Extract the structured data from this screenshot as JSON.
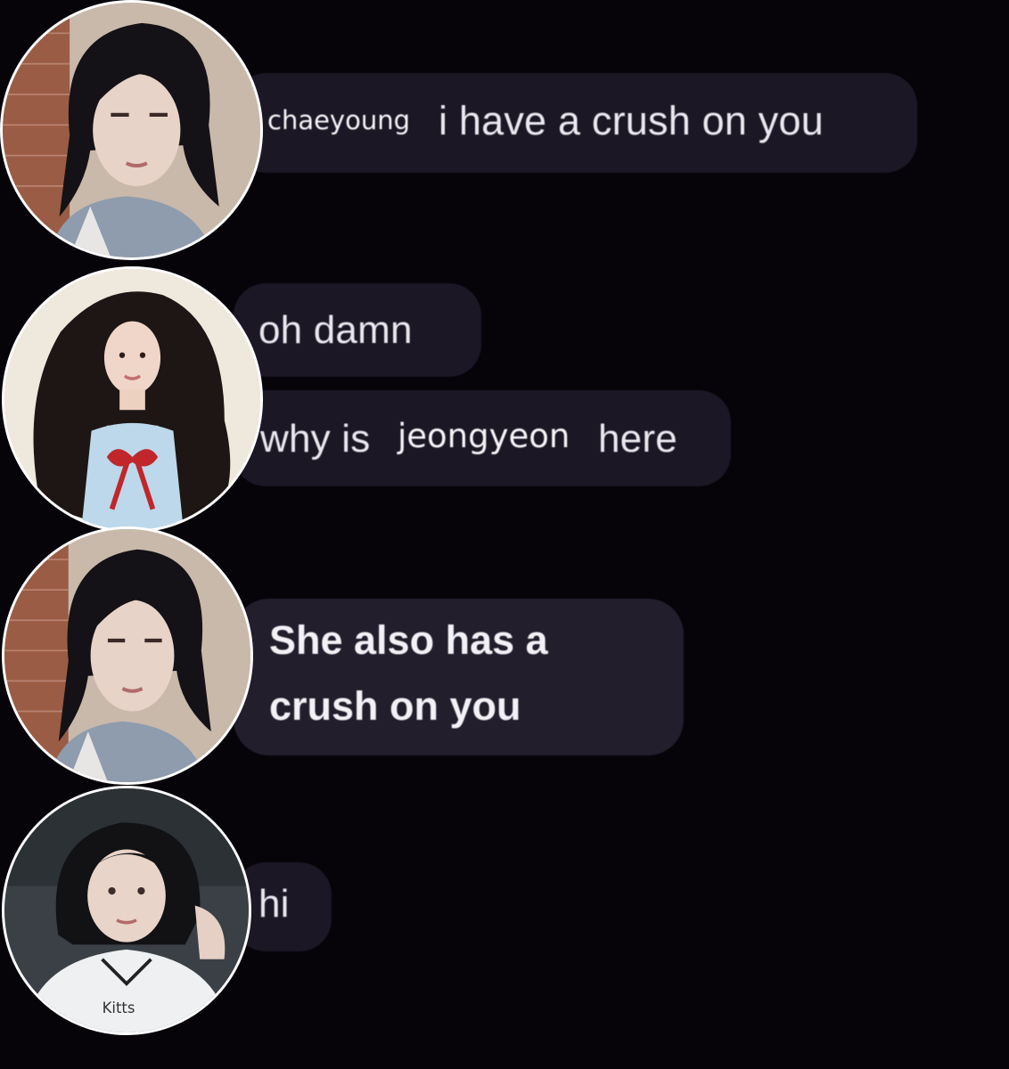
{
  "messages": [
    {
      "sender_overlay": "chaeyoung",
      "text": "i have a crush on you"
    },
    {
      "text": "oh damn"
    },
    {
      "text_before": "why is",
      "overlay_name": "jeongyeon",
      "text_after": "here"
    },
    {
      "text": "She also has a crush on you"
    },
    {
      "text": "hi"
    }
  ],
  "avatars": [
    {
      "icon": "profile-photo-icon"
    },
    {
      "icon": "profile-photo-icon"
    },
    {
      "icon": "profile-photo-icon"
    },
    {
      "icon": "profile-photo-icon"
    }
  ],
  "colors": {
    "background": "#060309",
    "bubble": "#1c1725",
    "bubble_highlight": "#231e2c",
    "text": "#ecebf2",
    "avatar_border": "#ffffff"
  },
  "shirt_print": "Kitts"
}
